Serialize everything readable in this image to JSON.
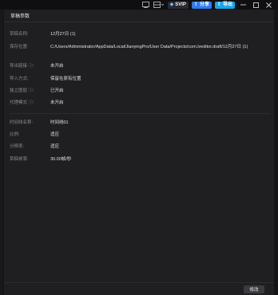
{
  "titlebar": {
    "svip_label": "SVIP",
    "share_label": "分享",
    "export_label": "导出"
  },
  "panel": {
    "title": "草稿参数",
    "rows": [
      {
        "label": "草稿名称:",
        "value": "12月27日 (1)"
      },
      {
        "label": "保存位置:",
        "value": "C:/Users/Administrator/AppData/Local/JianyingPro/User Data/Projects/com.lveditor.draft/12月27日 (1)"
      },
      {
        "label": "导出链接 ⓘ:",
        "value": "未开启"
      },
      {
        "label": "导入方式:",
        "value": "保留在原有位置"
      },
      {
        "label": "独立图层 ⓘ:",
        "value": "已开启"
      },
      {
        "label": "代理模式 ⓘ:",
        "value": "未开启"
      },
      {
        "label": "时间线名称:",
        "value": "时间线01"
      },
      {
        "label": "比例:",
        "value": "适应"
      },
      {
        "label": "分辨率:",
        "value": "适应"
      },
      {
        "label": "草稿帧率:",
        "value": "30.00帧/秒"
      }
    ]
  },
  "footer": {
    "modify_label": "修改"
  }
}
